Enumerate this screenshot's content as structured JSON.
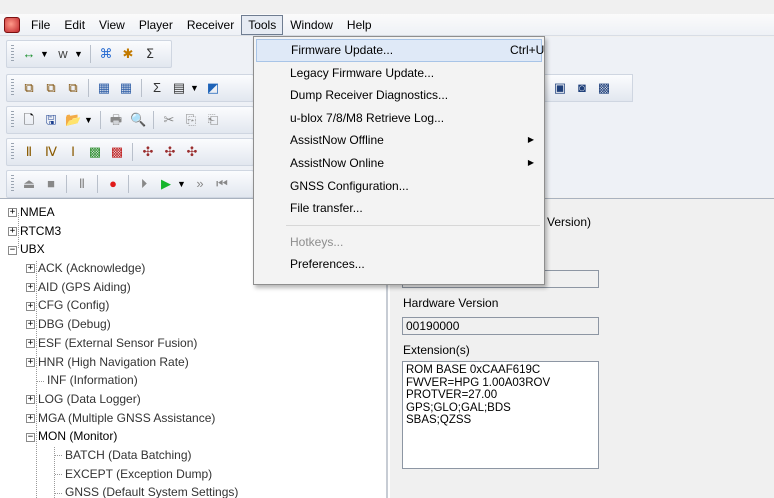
{
  "menubar": {
    "items": [
      "File",
      "Edit",
      "View",
      "Player",
      "Receiver",
      "Tools",
      "Window",
      "Help"
    ]
  },
  "toolbars": {
    "row1": [
      "↔",
      "w",
      "⌘",
      "✱",
      "ⵉ"
    ],
    "row2": [
      "⧉",
      "⧉",
      "⧉",
      "▦",
      "▦",
      "Σ",
      "▤",
      "◩"
    ],
    "row3": [
      "🗋",
      "🖫",
      "📂",
      "🖶",
      "🔍",
      "✂",
      "⎘",
      "⎗"
    ],
    "row4": [
      "Ⅱ",
      "Ⅳ",
      "Ⅰ",
      "▩",
      "▩",
      "✣",
      "✣",
      "✣"
    ],
    "row5": [
      "⏏",
      "■",
      "Ⅱ",
      "●",
      "⏵",
      "▶",
      "»",
      "⏮"
    ],
    "right_icons": [
      "▣",
      "◙",
      "▩"
    ]
  },
  "tools_menu": {
    "items": [
      {
        "label": "Firmware Update...",
        "shortcut": "Ctrl+U"
      },
      {
        "label": "Legacy Firmware Update..."
      },
      {
        "label": "Dump Receiver Diagnostics..."
      },
      {
        "label": "u-blox 7/8/M8 Retrieve Log..."
      },
      {
        "label": "AssistNow Offline"
      },
      {
        "label": "AssistNow Online"
      },
      {
        "label": "GNSS Configuration..."
      },
      {
        "label": "File transfer..."
      },
      {
        "label": "Hotkeys..."
      },
      {
        "label": "Preferences..."
      }
    ]
  },
  "tree": {
    "nmea": "NMEA",
    "rtcm3": "RTCM3",
    "ubx": "UBX",
    "children": [
      "ACK (Acknowledge)",
      "AID (GPS Aiding)",
      "CFG (Config)",
      "DBG (Debug)",
      "ESF (External Sensor Fusion)",
      "HNR (High Navigation Rate)",
      "INF (Information)",
      "LOG (Data Logger)",
      "MGA (Multiple GNSS Assistance)",
      "MON (Monitor)"
    ],
    "mon_children": [
      "BATCH (Data Batching)",
      "EXCEPT (Exception Dump)",
      "GNSS (Default System Settings)"
    ]
  },
  "details": {
    "header_partial": "Version)",
    "hardware_label": "Hardware Version",
    "hardware_value": "00190000",
    "extension_label": "Extension(s)",
    "extension_text": "ROM BASE 0xCAAF619C\nFWVER=HPG 1.00A03ROV\nPROTVER=27.00\nGPS;GLO;GAL;BDS\nSBAS;QZSS"
  }
}
